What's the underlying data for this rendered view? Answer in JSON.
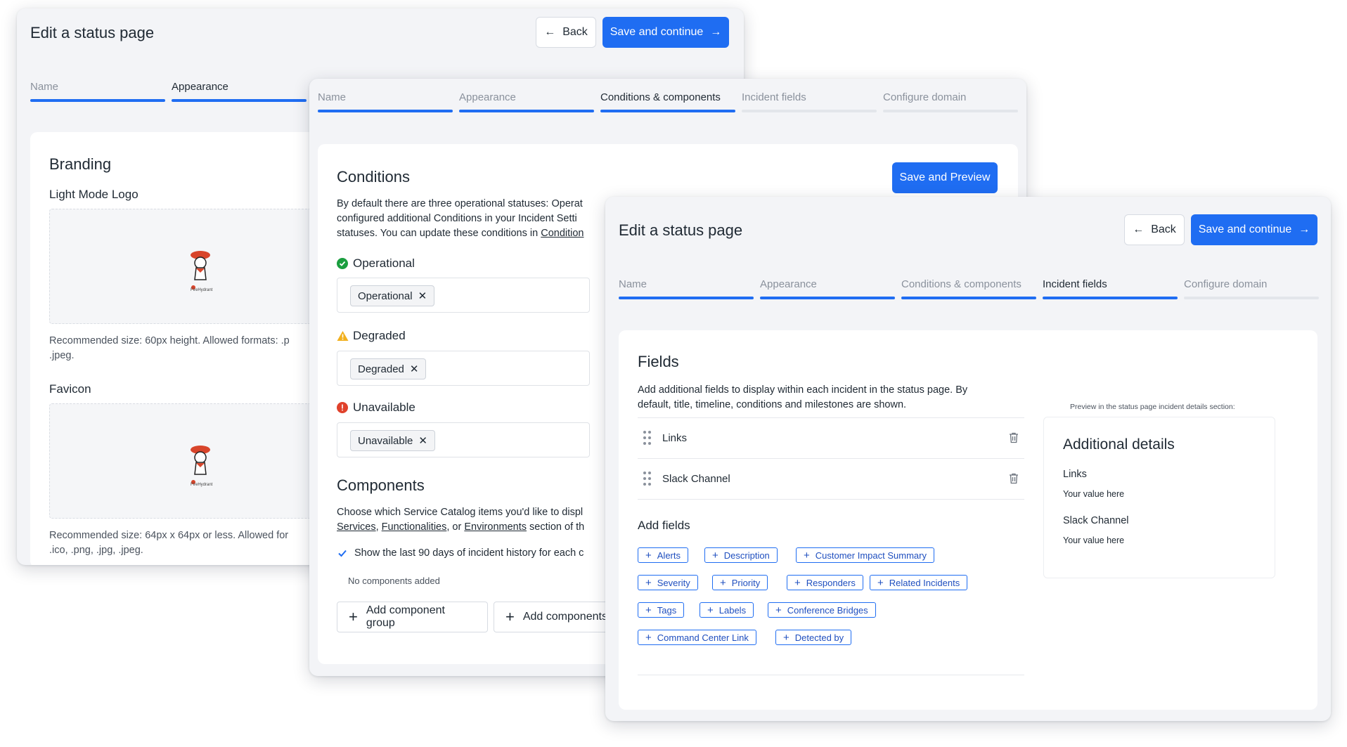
{
  "colors": {
    "primary": "#1f6df2",
    "success": "#1a9e3f",
    "warning": "#f2b01e",
    "danger": "#e0412b"
  },
  "win1": {
    "title": "Edit a status page",
    "back": "Back",
    "save": "Save and continue",
    "steps": [
      "Name",
      "Appearance"
    ],
    "branding": {
      "heading": "Branding",
      "light_logo_label": "Light Mode Logo",
      "light_logo_hint_1": "Recommended size: 60px height. Allowed formats: .p",
      "light_logo_hint_2": ".jpeg.",
      "favicon_label": "Favicon",
      "favicon_hint_1": "Recommended size: 64px x 64px or less. Allowed for",
      "favicon_hint_2": ".ico, .png, .jpg, .jpeg.",
      "logo_text": "FireHydrant"
    }
  },
  "win2": {
    "steps": [
      "Name",
      "Appearance",
      "Conditions & components",
      "Incident fields",
      "Configure domain"
    ],
    "save_preview": "Save and Preview",
    "conditions": {
      "heading": "Conditions",
      "desc_1": "By default there are three operational statuses: Operat",
      "desc_2": "configured additional Conditions in your Incident Setti",
      "desc_3": "statuses. You can update these conditions in ",
      "desc_link": "Condition",
      "items": [
        {
          "label": "Operational",
          "chip": "Operational"
        },
        {
          "label": "Degraded",
          "chip": "Degraded"
        },
        {
          "label": "Unavailable",
          "chip": "Unavailable"
        }
      ]
    },
    "components": {
      "heading": "Components",
      "desc_1": "Choose which Service Catalog items you'd like to displ",
      "link_services": "Services",
      "link_functionalities": "Functionalities",
      "or": ", or ",
      "link_environments": "Environments",
      "desc_2_tail": " section of th",
      "checkbox_label": "Show the last 90 days of incident history for each c",
      "empty": "No components added",
      "add_group": "Add component group",
      "add_components": "Add components"
    }
  },
  "win3": {
    "title": "Edit a status page",
    "back": "Back",
    "save": "Save and continue",
    "steps": [
      "Name",
      "Appearance",
      "Conditions & components",
      "Incident fields",
      "Configure domain"
    ],
    "fields": {
      "heading": "Fields",
      "desc_1": "Add additional fields to display within each incident in the status page. By",
      "desc_2": "default, title, timeline, conditions and milestones are shown.",
      "rows": [
        "Links",
        "Slack Channel"
      ],
      "add_heading": "Add fields",
      "pills": [
        [
          "Alerts",
          "Description",
          "Customer Impact Summary"
        ],
        [
          "Severity",
          "Priority",
          "Responders",
          "Related Incidents"
        ],
        [
          "Tags",
          "Labels",
          "Conference Bridges"
        ],
        [
          "Command Center Link",
          "Detected by"
        ]
      ]
    },
    "preview": {
      "caption": "Preview in the status page incident details section:",
      "heading": "Additional details",
      "items": [
        {
          "label": "Links",
          "value": "Your value here"
        },
        {
          "label": "Slack Channel",
          "value": "Your value here"
        }
      ]
    }
  }
}
